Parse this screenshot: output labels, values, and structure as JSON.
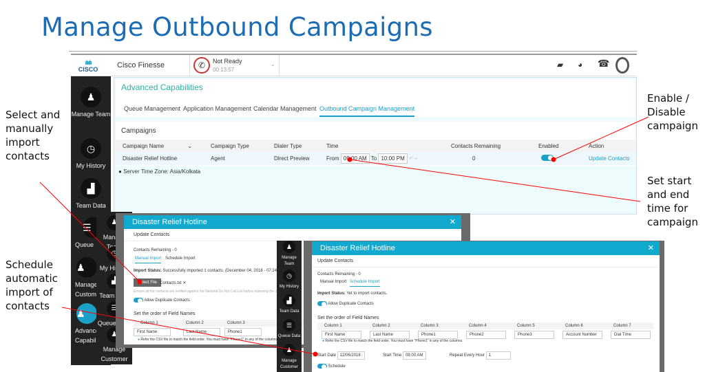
{
  "slide": {
    "title": "Manage Outbound Campaigns",
    "notes": {
      "enable": "Enable / Disable campaign",
      "time": "Set start and end time for campaign",
      "manual": "Select and manually import contacts",
      "schedule": "Schedule automatic import of contacts"
    }
  },
  "header": {
    "logo": "CISCO",
    "app": "Cisco Finesse",
    "status": "Not Ready",
    "timer": "00:13:57"
  },
  "sidebar": [
    "Manage Team",
    "My History",
    "Team Data",
    "Queue",
    "Manage Customer",
    "Advanced Capabilities"
  ],
  "sidebar_small": [
    "Manage Team",
    "My History",
    "Team Data",
    "Queue Data",
    "Manage Customer"
  ],
  "panel": {
    "title": "Advanced Capabilities",
    "tabs": [
      "Queue Management",
      "Application Management",
      "Calendar Management",
      "Outbound Campaign Management"
    ],
    "active_tab": 3,
    "section": "Campaigns",
    "columns": [
      "Campaign Name",
      "Campaign Type",
      "Dialer Type",
      "Time",
      "Contacts Remaining",
      "Enabled",
      "Action"
    ],
    "row": {
      "name": "Disaster Relief Hotline",
      "type": "Agent",
      "dialer": "Direct Preview",
      "from_label": "From",
      "from": "09:00 AM",
      "to_label": "To",
      "to": "10:00 PM",
      "remaining": "0",
      "enabled": true,
      "action": "Update Contacts"
    },
    "timezone": "Server Time Zone: Asia/Kolkata"
  },
  "dialog1": {
    "title": "Disaster Relief Hotline",
    "subtitle": "Update Contacts",
    "remaining": "Contacts Remaining - 0",
    "tabs": [
      "Manual Import",
      "Schedule Import"
    ],
    "status_label": "Import Status:",
    "status": "Successfully imported 1 contacts. (December 04, 2018 - 07:24 PM)",
    "select_file": "Select File",
    "file": "Contacts.txt",
    "warning": "Ensure all the contacts are verified against the National Do Not Call List before importing the contacts.",
    "allow_dup": "Allow Duplicate Contacts",
    "order_title": "Set the order of Field Names",
    "columns": [
      "Column 1",
      "Column 2",
      "Column 3"
    ],
    "values": [
      "First Name",
      "Last Name",
      "Phone1"
    ],
    "hint": "Refer the CSV file to match the field order. You must have \"Phone1\" in any of the columns."
  },
  "dialog2": {
    "title": "Disaster Relief Hotline",
    "subtitle": "Update Contacts",
    "remaining": "Contacts Remaining - 0",
    "tabs": [
      "Manual Import",
      "Schedule Import"
    ],
    "status_label": "Import Status:",
    "status": "Yet to import contacts.",
    "allow_dup": "Allow Duplicate Contacts",
    "order_title": "Set the order of Field Names",
    "columns": [
      "Column 1",
      "Column 2",
      "Column 3",
      "Column 4",
      "Column 5",
      "Column 6",
      "Column 7"
    ],
    "values": [
      "First Name",
      "Last Name",
      "Phone1",
      "Phone2",
      "Phone3",
      "Account Number",
      "Dial Time"
    ],
    "hint": "Refer the CSV file to match the field order. You must have \"Phone1\" in any of the columns.",
    "start_date_label": "Start Date",
    "start_date": "12/06/2018",
    "start_time_label": "Start Time",
    "start_time": "08:00 AM",
    "repeat_label": "Repeat Every Hour",
    "repeat": "1",
    "schedule": "Schedule"
  },
  "colors": {
    "accent": "#12a9cf",
    "title": "#1a6cb5",
    "annotation": "#ff0000",
    "sidebar": "#222222"
  }
}
